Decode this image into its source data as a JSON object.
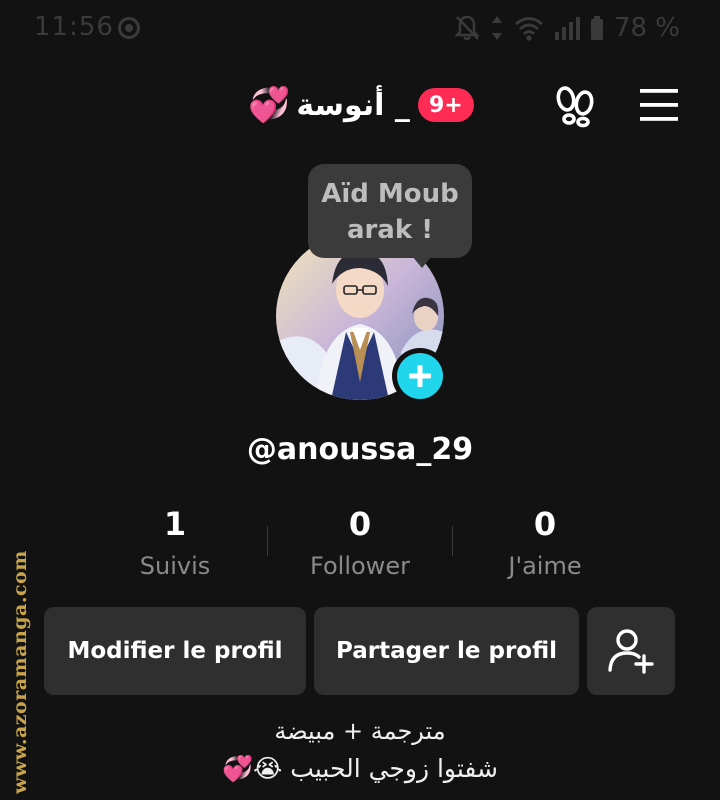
{
  "status_bar": {
    "time": "11:56",
    "battery_percent": "78 %",
    "icons": [
      "whatsapp-icon",
      "bell-off-icon",
      "data-arrows-icon",
      "wifi-icon",
      "signal-icon",
      "battery-icon"
    ]
  },
  "header": {
    "title": "أنوسة _",
    "title_emoji": "💞",
    "notification_badge": "9+",
    "icons": [
      "footprint-icon",
      "menu-icon"
    ]
  },
  "tooltip": {
    "text": "Aïd Moub arak !"
  },
  "profile": {
    "username": "@anoussa_29",
    "avatar_add_icon": "plus-icon"
  },
  "stats": [
    {
      "value": "1",
      "label": "Suivis"
    },
    {
      "value": "0",
      "label": "Follower"
    },
    {
      "value": "0",
      "label": "J'aime"
    }
  ],
  "actions": {
    "edit_profile": "Modifier le profil",
    "share_profile": "Partager le profil",
    "add_friend_icon": "add-user-icon"
  },
  "bio": {
    "line1": "مترجمة + مبيضة",
    "line2": "شفتوا زوجي الحبيب 😭💞"
  },
  "watermark": {
    "text": "www.azoramanga.com"
  },
  "colors": {
    "background": "#121212",
    "badge": "#fe2c55",
    "add_button": "#20d5ec",
    "button_bg": "#2f2f2f",
    "secondary_text": "#8a8a8a",
    "watermark": "#c8a44a"
  }
}
